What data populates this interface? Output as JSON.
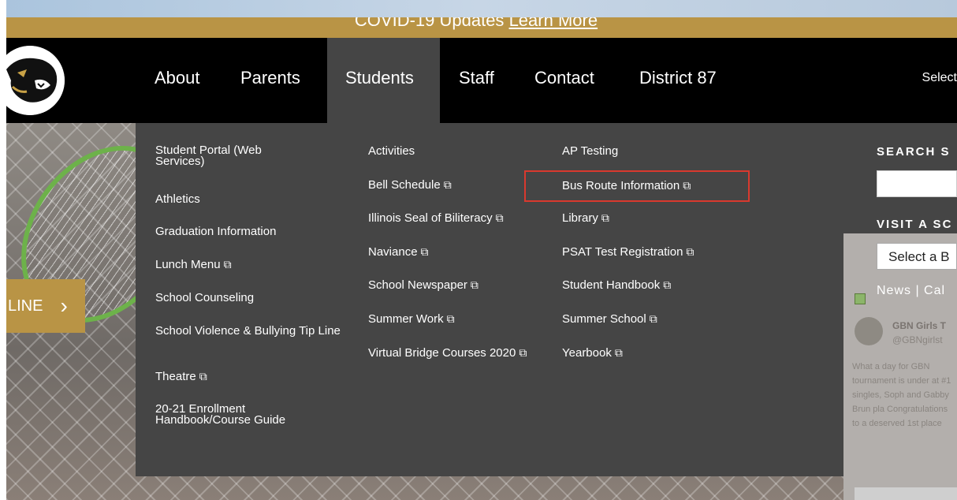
{
  "alert": {
    "text": "COVID-19 Updates",
    "link": "Learn More"
  },
  "nav": {
    "items": [
      "About",
      "Parents",
      "Students",
      "Staff",
      "Contact",
      "District 87"
    ],
    "select_label": "Select"
  },
  "hero": {
    "timeline_label": "LINE"
  },
  "menu": {
    "col1": [
      "Student Portal (Web Services)",
      "Athletics",
      "Graduation Information",
      "Lunch Menu",
      "School Counseling",
      "School Violence & Bullying Tip Line",
      "Theatre",
      "20-21 Enrollment Handbook/Course Guide"
    ],
    "col2": [
      "Activities",
      "Bell Schedule",
      "Illinois Seal of Biliteracy",
      "Naviance",
      "School Newspaper",
      "Summer Work",
      "Virtual Bridge Courses 2020"
    ],
    "col3": [
      "AP Testing",
      "Bus Route Information",
      "Library",
      "PSAT Test Registration",
      "Student Handbook",
      "Summer School",
      "Yearbook"
    ]
  },
  "side": {
    "search_title": "SEARCH S",
    "visit_title": "VISIT A SC",
    "select_placeholder": "Select a B",
    "news_cal": "News | Cal",
    "tweet_name": "GBN Girls T",
    "tweet_handle": "@GBNgirlst",
    "tweet_text": "What a day for GBN tournament is under at #1 singles, Soph and Gabby Brun pla Congratulations to a deserved 1st place"
  },
  "colors": {
    "gold": "#b99445",
    "menu_bg": "#454545",
    "highlight": "#d9392e"
  }
}
